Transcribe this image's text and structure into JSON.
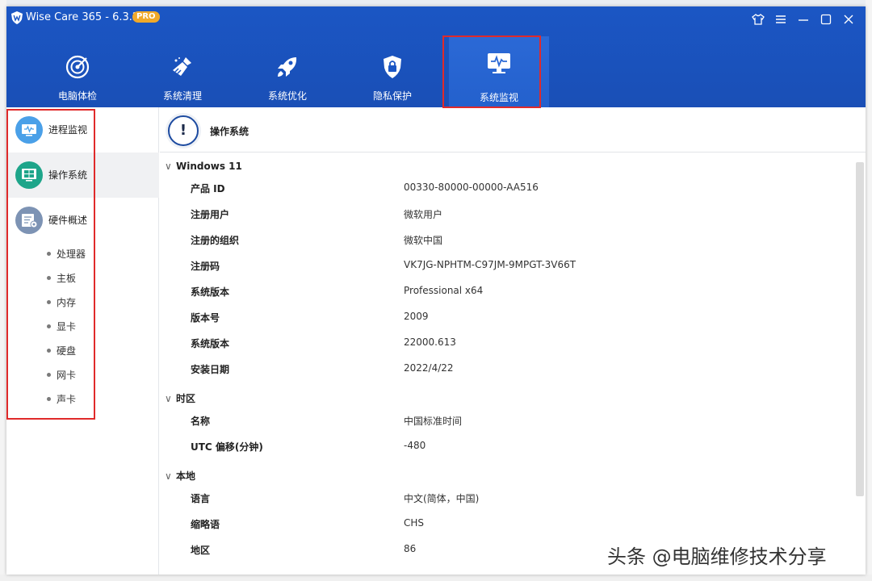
{
  "app": {
    "title": "Wise Care 365 - 6.3.2",
    "badge": "PRO"
  },
  "colors": {
    "header": "#1b56c4",
    "active_tab": "#2b69d6",
    "highlight_border": "#e02a2a",
    "sidebar_active": "#f0f1f3"
  },
  "tabs": [
    {
      "label": "电脑体检",
      "icon": "target-icon"
    },
    {
      "label": "系统清理",
      "icon": "broom-icon"
    },
    {
      "label": "系统优化",
      "icon": "rocket-icon"
    },
    {
      "label": "隐私保护",
      "icon": "lock-shield-icon"
    },
    {
      "label": "系统监视",
      "icon": "monitor-icon",
      "active": true
    }
  ],
  "sidebar": {
    "items": [
      {
        "label": "进程监视",
        "icon": "monitor-icon"
      },
      {
        "label": "操作系统",
        "icon": "windows-icon",
        "active": true
      },
      {
        "label": "硬件概述",
        "icon": "hardware-icon"
      }
    ],
    "sub_items": [
      "处理器",
      "主板",
      "内存",
      "显卡",
      "硬盘",
      "网卡",
      "声卡"
    ]
  },
  "content": {
    "title": "操作系统",
    "sections": [
      {
        "title": "Windows 11",
        "rows": [
          {
            "key": "产品 ID",
            "value": "00330-80000-00000-AA516"
          },
          {
            "key": "注册用户",
            "value": "微软用户"
          },
          {
            "key": "注册的组织",
            "value": "微软中国"
          },
          {
            "key": "注册码",
            "value": "VK7JG-NPHTM-C97JM-9MPGT-3V66T"
          },
          {
            "key": "系统版本",
            "value": "Professional x64"
          },
          {
            "key": "版本号",
            "value": "2009"
          },
          {
            "key": "系统版本",
            "value": "22000.613"
          },
          {
            "key": "安装日期",
            "value": "2022/4/22"
          }
        ]
      },
      {
        "title": "时区",
        "rows": [
          {
            "key": "名称",
            "value": "中国标准时间"
          },
          {
            "key": "UTC 偏移(分钟)",
            "value": "-480"
          }
        ]
      },
      {
        "title": "本地",
        "rows": [
          {
            "key": "语言",
            "value": "中文(简体，中国)"
          },
          {
            "key": "缩略语",
            "value": "CHS"
          },
          {
            "key": "地区",
            "value": "86"
          }
        ]
      }
    ]
  },
  "watermark": "头条 @电脑维修技术分享"
}
